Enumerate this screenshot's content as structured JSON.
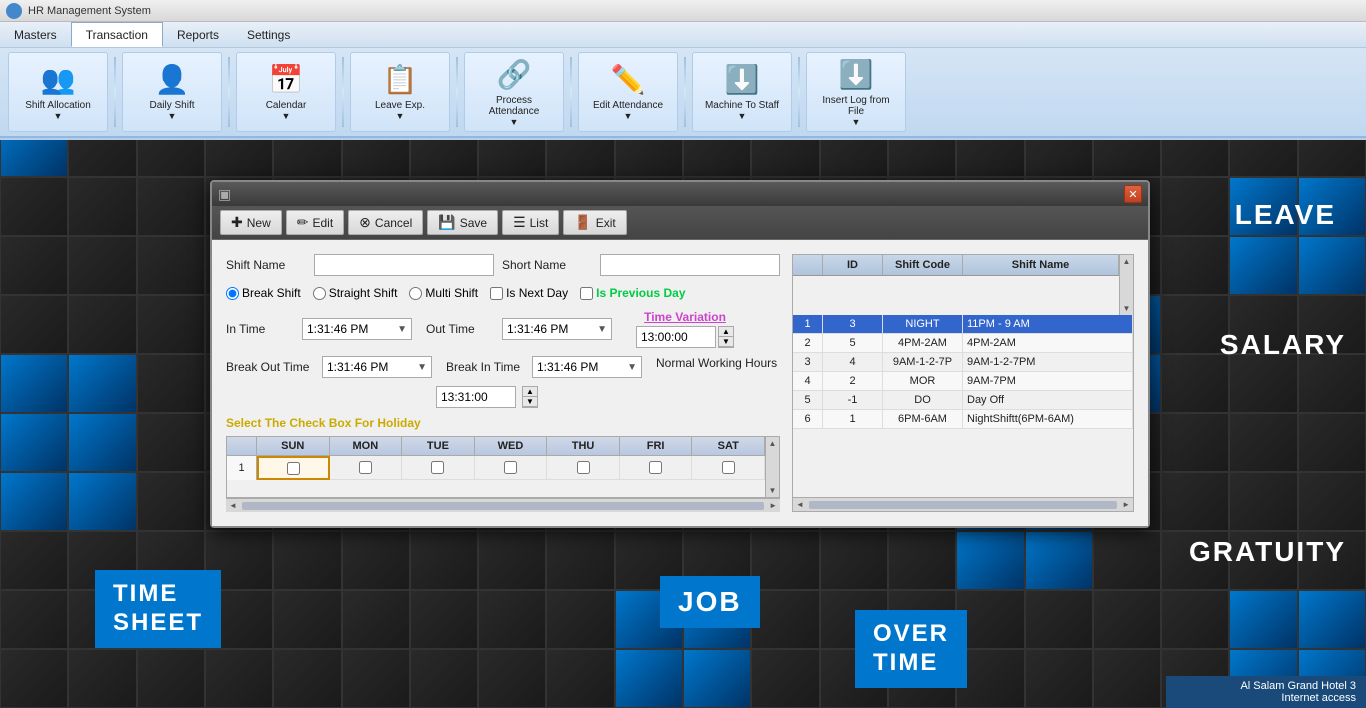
{
  "app": {
    "title": "Al Salam Grand Hotel  3",
    "subtitle": "Internet access"
  },
  "menu": {
    "items": [
      "Masters",
      "Transaction",
      "Reports",
      "Settings"
    ]
  },
  "toolbar": {
    "buttons": [
      {
        "label": "Shift Allocation",
        "icon": "👥"
      },
      {
        "label": "Daily Shift",
        "icon": "👤"
      },
      {
        "label": "Calendar",
        "icon": "📅"
      },
      {
        "label": "Leave Exp.",
        "icon": "📋"
      },
      {
        "label": "Process Attendance",
        "icon": "🔗"
      },
      {
        "label": "Edit Attendance",
        "icon": "✏️"
      },
      {
        "label": "Machine To Staff",
        "icon": "⬇️"
      },
      {
        "label": "Insert Log from File",
        "icon": "⬇️"
      }
    ]
  },
  "dialog": {
    "buttons": [
      "New",
      "Edit",
      "Cancel",
      "Save",
      "List",
      "Exit"
    ],
    "form": {
      "shift_name_label": "Shift Name",
      "short_name_label": "Short Name",
      "shift_name_value": "",
      "short_name_value": "",
      "radio_options": [
        "Break Shift",
        "Straight Shift",
        "Multi Shift"
      ],
      "radio_selected": "Break Shift",
      "check_is_next_day": "Is Next Day",
      "check_is_previous_day": "Is Previous Day",
      "in_time_label": "In Time",
      "in_time_value": "1:31:46 PM",
      "out_time_label": "Out Time",
      "out_time_value": "1:31:46 PM",
      "break_out_label": "Break Out Time",
      "break_out_value": "1:31:46 PM",
      "break_in_label": "Break In Time",
      "break_in_value": "1:31:46 PM",
      "time_variation_label": "Time Variation",
      "time_variation_value": "13:00:00",
      "normal_working_hours_label": "Normal Working Hours",
      "normal_working_hours_value": "13:31:00",
      "holiday_label": "Select The Check Box For Holiday",
      "day_headers": [
        "SUN",
        "MON",
        "TUE",
        "WED",
        "THU",
        "FRI",
        "SAT"
      ],
      "previous_day_text": "Previous Day"
    },
    "table": {
      "headers": [
        "ID",
        "Shift Code",
        "Shift Name"
      ],
      "rows": [
        {
          "num": 1,
          "id": "3",
          "code": "NIGHT",
          "name": "11PM - 9 AM",
          "selected": true
        },
        {
          "num": 2,
          "id": "5",
          "code": "4PM-2AM",
          "name": "4PM-2AM",
          "selected": false
        },
        {
          "num": 3,
          "id": "4",
          "code": "9AM-1-2-7P",
          "name": "9AM-1-2-7PM",
          "selected": false
        },
        {
          "num": 4,
          "id": "2",
          "code": "MOR",
          "name": "9AM-7PM",
          "selected": false
        },
        {
          "num": 5,
          "id": "-1",
          "code": "DO",
          "name": "Day Off",
          "selected": false
        },
        {
          "num": 6,
          "id": "1",
          "code": "6PM-6AM",
          "name": "NightShiftt(6PM-6AM)",
          "selected": false
        }
      ]
    }
  },
  "corner_labels": {
    "leave": "LEAVE",
    "salary": "SALARY",
    "gratuity": "GRATUITY",
    "timesheet": "TIME\nSHEET",
    "job": "JOB",
    "overtime": "OVER\nTIME"
  }
}
